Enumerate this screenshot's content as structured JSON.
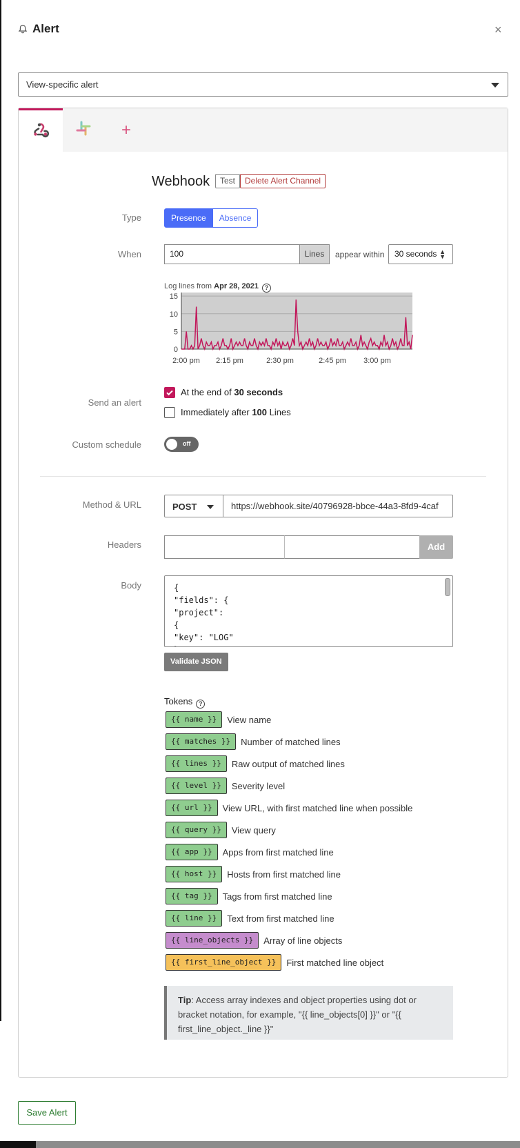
{
  "header": {
    "title": "Alert",
    "close_glyph": "×"
  },
  "alert_type_select": {
    "value": "View-specific alert"
  },
  "tabs": [
    {
      "icon": "webhook-icon",
      "active": true
    },
    {
      "icon": "slack-icon",
      "active": false
    },
    {
      "icon": "add-channel-icon",
      "glyph": "+",
      "active": false
    }
  ],
  "channel": {
    "title": "Webhook",
    "test_label": "Test",
    "delete_label": "Delete Alert Channel"
  },
  "type": {
    "label": "Type",
    "options": [
      "Presence",
      "Absence"
    ],
    "selected": "Presence"
  },
  "when": {
    "label": "When",
    "value": "100",
    "unit": "Lines",
    "connector": "appear within",
    "duration": "30 seconds"
  },
  "chart_caption": {
    "prefix": "Log lines from ",
    "date": "Apr 28, 2021"
  },
  "chart_data": {
    "type": "line",
    "title": "Log lines from Apr 28, 2021",
    "xlabel": "",
    "ylabel": "",
    "ylim": [
      0,
      16
    ],
    "yticks": [
      0,
      5,
      10,
      15
    ],
    "xticks": [
      "2:00 pm",
      "2:15 pm",
      "2:30 pm",
      "2:45 pm",
      "3:00 pm"
    ],
    "grid": true,
    "series": [
      {
        "color": "#c2185b",
        "values": [
          0,
          0,
          0,
          5,
          0,
          0,
          1,
          0,
          1,
          12,
          0,
          1,
          3,
          1,
          0,
          2,
          1,
          1,
          2,
          0,
          1,
          1,
          2,
          0,
          1,
          3,
          1,
          1,
          0,
          1,
          3,
          0,
          1,
          2,
          1,
          2,
          1,
          1,
          3,
          1,
          0,
          2,
          1,
          1,
          3,
          1,
          0,
          2,
          1,
          2,
          1,
          3,
          1,
          1,
          0,
          2,
          1,
          3,
          1,
          2,
          0,
          2,
          1,
          1,
          2,
          0,
          1,
          3,
          1,
          14,
          5,
          1,
          2,
          0,
          1,
          2,
          1,
          3,
          1,
          2,
          0,
          1,
          3,
          1,
          2,
          1,
          1,
          2,
          0,
          1,
          3,
          1,
          2,
          1,
          3,
          1,
          1,
          2,
          0,
          1,
          2,
          1,
          3,
          1,
          1,
          2,
          0,
          1,
          4,
          1,
          2,
          1,
          0,
          2,
          3,
          1,
          2,
          1,
          1,
          0,
          2,
          1,
          4,
          1,
          2,
          0,
          1,
          3,
          1,
          2,
          0,
          1,
          3,
          1,
          1,
          9,
          1,
          2,
          0,
          4
        ]
      }
    ]
  },
  "send_alert": {
    "label": "Send an alert",
    "option1": {
      "prefix": "At the end of ",
      "bold": "30 seconds",
      "checked": true
    },
    "option2": {
      "prefix": "Immediately after ",
      "bold": "100",
      "suffix": " Lines",
      "checked": false
    }
  },
  "custom_schedule": {
    "label": "Custom schedule",
    "state": "off"
  },
  "method_url": {
    "label": "Method & URL",
    "method": "POST",
    "url": "https://webhook.site/40796928-bbce-44a3-8fd9-4caf"
  },
  "headers": {
    "label": "Headers",
    "add_label": "Add"
  },
  "body": {
    "label": "Body",
    "text": "{\n\"fields\": {\n\"project\":\n{\n\"key\": \"LOG\"\n}"
  },
  "validate_label": "Validate JSON",
  "tokens": {
    "title": "Tokens",
    "items": [
      {
        "token": "{{ name }}",
        "desc": "View name",
        "color": "green"
      },
      {
        "token": "{{ matches }}",
        "desc": "Number of matched lines",
        "color": "green"
      },
      {
        "token": "{{ lines }}",
        "desc": "Raw output of matched lines",
        "color": "green"
      },
      {
        "token": "{{ level }}",
        "desc": "Severity level",
        "color": "green"
      },
      {
        "token": "{{ url }}",
        "desc": "View URL, with first matched line when possible",
        "color": "green"
      },
      {
        "token": "{{ query }}",
        "desc": "View query",
        "color": "green"
      },
      {
        "token": "{{ app }}",
        "desc": "Apps from first matched line",
        "color": "green"
      },
      {
        "token": "{{ host }}",
        "desc": "Hosts from first matched line",
        "color": "green"
      },
      {
        "token": "{{ tag }}",
        "desc": "Tags from first matched line",
        "color": "green"
      },
      {
        "token": "{{ line }}",
        "desc": "Text from first matched line",
        "color": "green"
      },
      {
        "token": "{{ line_objects }}",
        "desc": "Array of line objects",
        "color": "purple"
      },
      {
        "token": "{{ first_line_object }}",
        "desc": "First matched line object",
        "color": "orange"
      }
    ]
  },
  "tip": {
    "bold": "Tip",
    "text": ": Access array indexes and object properties using dot or bracket notation, for example, \"{{ line_objects[0] }}\" or \"{{ first_line_object._line }}\""
  },
  "save_label": "Save Alert"
}
